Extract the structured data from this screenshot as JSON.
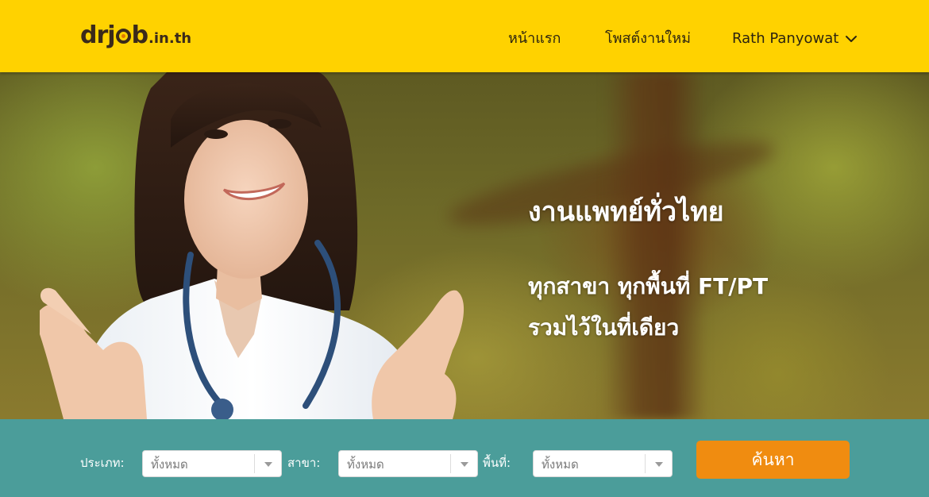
{
  "header": {
    "logo_main": "drj",
    "logo_after": "b",
    "logo_tld": ".in.th",
    "nav_home": "หน้าแรก",
    "nav_post_job": "โพสต์งานใหม่",
    "user_name": "Rath Panyowat",
    "user_menu_icon": "chevron-down-icon"
  },
  "hero": {
    "title": "งานแพทย์ทั่วไทย",
    "subtitle_line1": "ทุกสาขา ทุกพื้นที่ FT/PT",
    "subtitle_line2": "รวมไว้ในที่เดียว"
  },
  "search": {
    "type_label": "ประเภท:",
    "type_value": "ทั้งหมด",
    "branch_label": "สาขา:",
    "branch_value": "ทั้งหมด",
    "area_label": "พื้นที่:",
    "area_value": "ทั้งหมด",
    "button_label": "ค้นหา"
  },
  "colors": {
    "header_bg": "#ffd200",
    "search_bar_bg": "#4b9d9a",
    "button_bg": "#f08c10",
    "logo_text": "#3b2a1a"
  }
}
